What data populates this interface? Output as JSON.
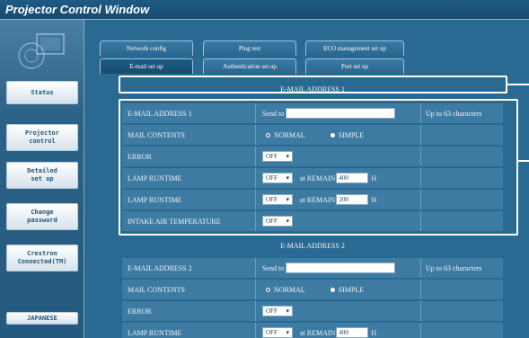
{
  "window": {
    "title": "Projector Control Window"
  },
  "sidebar": {
    "items": [
      {
        "label": "Status"
      },
      {
        "label": "Projector\ncontrol"
      },
      {
        "label": "Detailed\nset up"
      },
      {
        "label": "Change\npassword"
      },
      {
        "label": "Crestron\nConnected(TM)"
      },
      {
        "label": "JAPANESE"
      }
    ]
  },
  "tabs": {
    "row1": [
      "Network config",
      "Ping test",
      "ECO management set up"
    ],
    "row2": [
      "E-mail set up",
      "Authentication set up",
      "Port set up"
    ],
    "active": "E-mail set up"
  },
  "sections": [
    {
      "header": "E-MAIL ADDRESS 1",
      "address_label": "E-MAIL ADDRESS 1",
      "send_to_label": "Send to",
      "send_to_value": "",
      "limit_note": "Up to 63 characters",
      "mail_contents_label": "MAIL CONTENTS",
      "mail_contents_options": [
        "NORMAL",
        "SIMPLE"
      ],
      "mail_contents_selected": "SIMPLE",
      "error_label": "ERROR",
      "error_value": "OFF",
      "lamp_rows": [
        {
          "label": "LAMP  RUNTIME",
          "value": "OFF",
          "remain_label": "at REMAIN",
          "remain_value": "400",
          "unit": "H"
        },
        {
          "label": "LAMP  RUNTIME",
          "value": "OFF",
          "remain_label": "at REMAIN",
          "remain_value": "200",
          "unit": "H"
        }
      ],
      "intake_label": "INTAKE AIR TEMPERATURE",
      "intake_value": "OFF"
    },
    {
      "header": "E-MAIL ADDRESS 2",
      "address_label": "E-MAIL ADDRESS 2",
      "send_to_label": "Send to",
      "send_to_value": "",
      "limit_note": "Up to 63 characters",
      "mail_contents_label": "MAIL CONTENTS",
      "mail_contents_options": [
        "NORMAL",
        "SIMPLE"
      ],
      "mail_contents_selected": "SIMPLE",
      "error_label": "ERROR",
      "error_value": "OFF",
      "lamp_rows": [
        {
          "label": "LAMP  RUNTIME",
          "value": "OFF",
          "remain_label": "at REMAIN",
          "remain_value": "400",
          "unit": "H"
        }
      ]
    }
  ],
  "colors": {
    "background": "#2a6a92",
    "row": "#3d7ba3",
    "highlight": "#ffffff"
  }
}
